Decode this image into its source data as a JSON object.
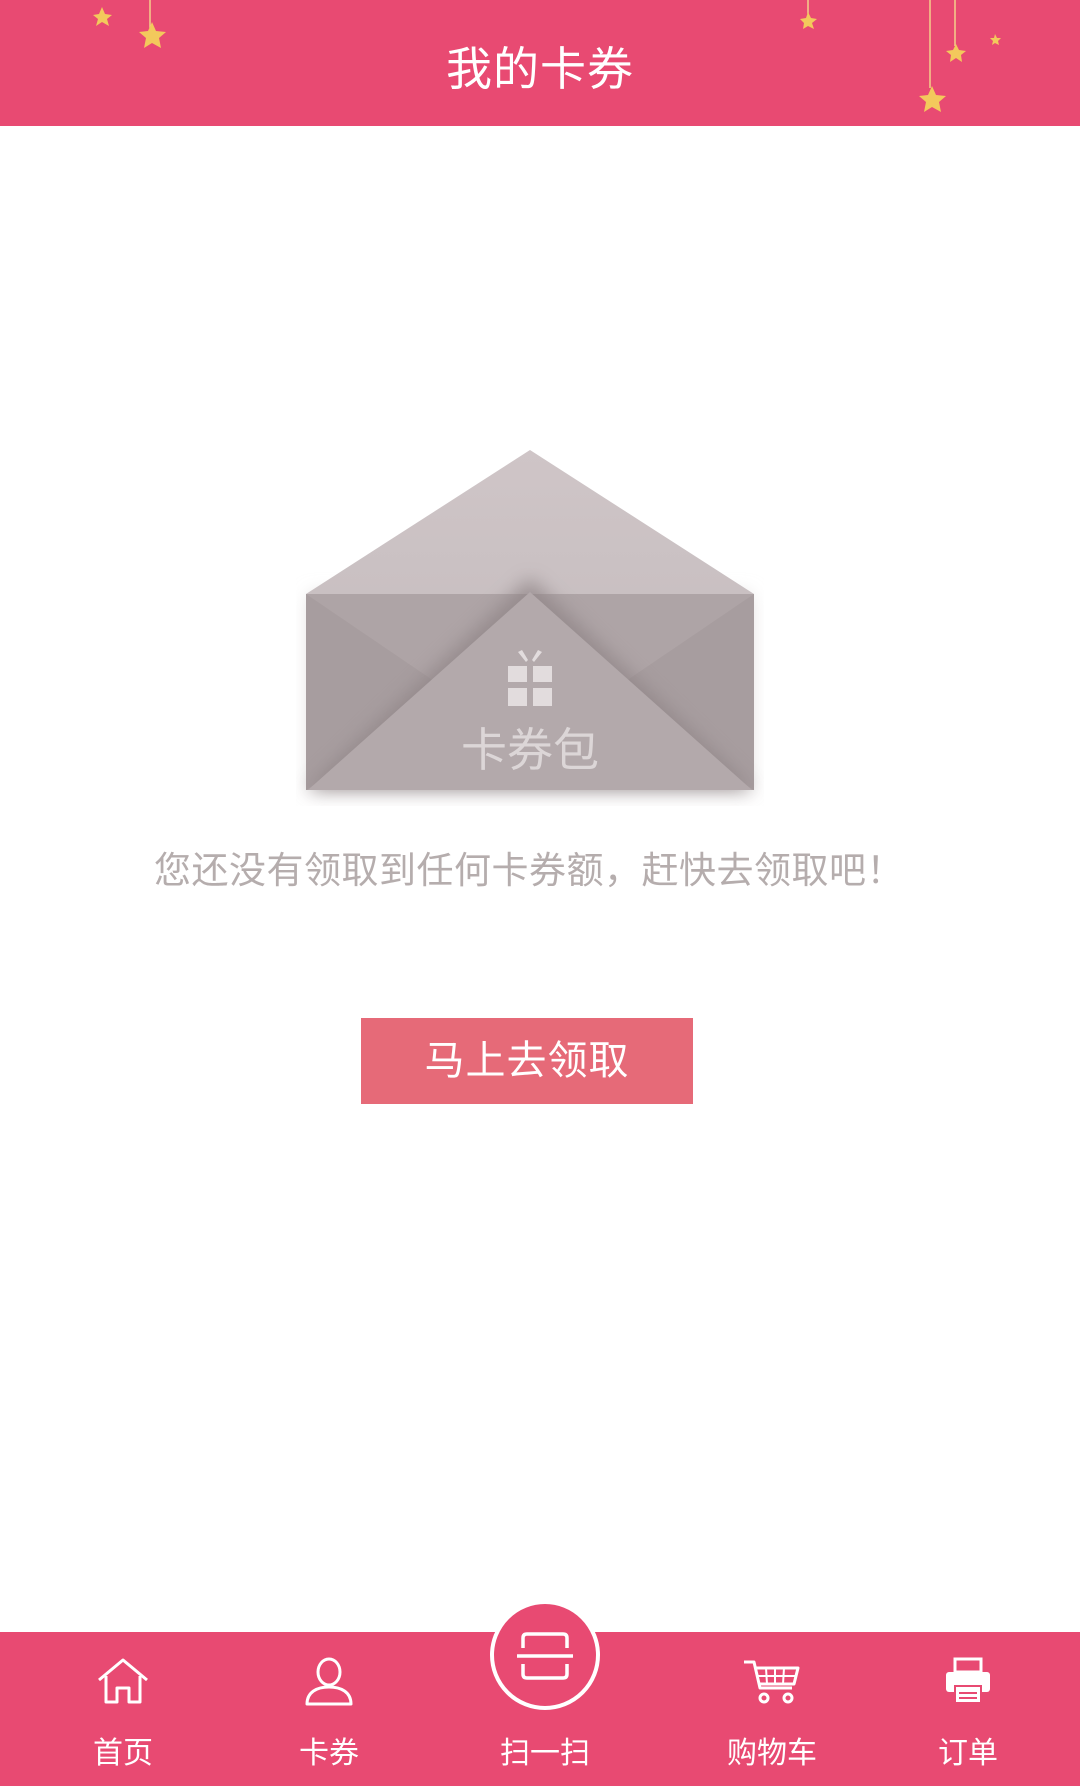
{
  "header": {
    "title": "我的卡券"
  },
  "empty_state": {
    "illustration_label": "卡券包",
    "message": "您还没有领取到任何卡券额，赶快去领取吧！",
    "button_label": "马上去领取"
  },
  "bottom_nav": {
    "items": [
      {
        "label": "首页",
        "icon": "home-icon"
      },
      {
        "label": "卡券",
        "icon": "user-icon"
      },
      {
        "label": "扫一扫",
        "icon": "scan-icon"
      },
      {
        "label": "购物车",
        "icon": "cart-icon"
      },
      {
        "label": "订单",
        "icon": "printer-icon"
      }
    ]
  },
  "colors": {
    "brand": "#e84a72",
    "button": "#e66a78",
    "muted_text": "#b5adad",
    "envelope": "#aea4a6"
  }
}
